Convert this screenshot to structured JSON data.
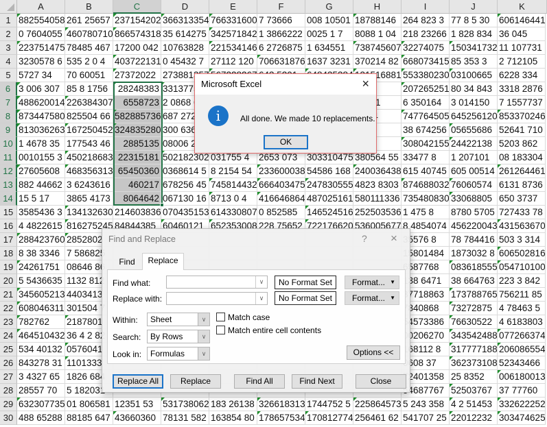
{
  "sheet": {
    "columns": [
      "A",
      "B",
      "C",
      "D",
      "E",
      "F",
      "G",
      "H",
      "I",
      "J",
      "K"
    ],
    "selected_column": "C",
    "selected_rows": [
      6,
      7,
      8,
      9,
      10,
      11,
      12,
      13,
      14
    ],
    "selection_range": "C6:C14",
    "active_cell": "C6",
    "accent_color": "#217346",
    "error_indicator_color": "#1e8f2c",
    "rows": [
      {
        "n": "1",
        "cells": [
          "882554058",
          "261 25657",
          "237154202",
          "366313354",
          "766331600",
          "7 73666",
          "008 10501",
          "18788146",
          "264 823 3",
          "77 8 5 30",
          "606146441"
        ],
        "flags": "ACDEHK"
      },
      {
        "n": "2",
        "cells": [
          "0 7604055",
          "460780710",
          "866574318",
          "35 614275",
          "342571842",
          "1 3866222",
          "0025 1 7",
          "8088 1 04",
          "218 23266",
          "1 828 834",
          "36   045"
        ],
        "flags": "BCE"
      },
      {
        "n": "3",
        "cells": [
          "223751475",
          "78485 467",
          "17200 042",
          "10763828",
          "221534146",
          "6 2726875",
          "1 634551",
          "738745607",
          "32274075",
          "150341732",
          "11 107731"
        ],
        "flags": "AEHIJ"
      },
      {
        "n": "4",
        "cells": [
          "3230578 6",
          "535 2 0 4",
          "403722131",
          "0 45432 7",
          "27112 120",
          "706631876",
          "1637 3231",
          "370214 82",
          "668073415",
          "85 353 3",
          "2 712105"
        ],
        "flags": "CFI"
      },
      {
        "n": "5",
        "cells": [
          "5727 34",
          "70  60051",
          "27372022",
          "273881357",
          "567228267",
          "643  5201",
          "648435384",
          "131516881",
          "553380230",
          "03100665",
          "6228 334"
        ],
        "flags": "CEGHIJ"
      },
      {
        "n": "6",
        "cells": [
          "3 006 307",
          "85 8 1756",
          "28248383",
          "3313775",
          "",
          "",
          "",
          "6745",
          "207265251",
          "80 34 843",
          "3318 2876"
        ],
        "flags": "ACDI"
      },
      {
        "n": "7",
        "cells": [
          "488620014",
          "226384307",
          "6558723",
          "2 0868 6",
          "",
          "",
          "",
          "73831",
          "6  350164",
          "3 014150",
          "7 1557737"
        ],
        "flags": "AB"
      },
      {
        "n": "8",
        "cells": [
          "873447580",
          "825504 66",
          "582885736",
          "687 272",
          "",
          "",
          "",
          "517 4",
          "747764505",
          "645256120",
          "853370246"
        ],
        "flags": "ACIK"
      },
      {
        "n": "9",
        "cells": [
          "813036263",
          "167250452",
          "324835280",
          "300 636",
          "",
          "",
          "",
          "0036",
          "38 674256",
          "05655686",
          "52641 710"
        ],
        "flags": "ABCJ"
      },
      {
        "n": "10",
        "cells": [
          "1 4678 35",
          "177543 46",
          "2885135",
          "08006 2",
          "",
          "",
          "",
          "5255",
          "308042155",
          "24422138",
          "5203 862"
        ],
        "flags": "IJ"
      },
      {
        "n": "11",
        "cells": [
          "0010155 3",
          "450218683",
          "22315181",
          "502182302",
          "031755  4",
          "2653 073",
          "303310475",
          "380564 55",
          "33477 8",
          "1  207101",
          "08 183304"
        ],
        "flags": "BD"
      },
      {
        "n": "12",
        "cells": [
          "27605608",
          "468356313",
          "65450360",
          "0368614 5",
          "8 2154 54",
          "233600038",
          "54586 168",
          "240036438",
          "615 40745",
          "605 00514",
          "261264461"
        ],
        "flags": "ABFHK"
      },
      {
        "n": "13",
        "cells": [
          "882 44662",
          "3 6243616",
          "460217",
          "678256 45",
          "745814432",
          "666403475",
          "247830555",
          "4823 8303",
          "874688032",
          "76060574",
          "6131 8736"
        ],
        "flags": "EFGIJ"
      },
      {
        "n": "14",
        "cells": [
          "15 5  17",
          "3865 4173",
          "8064642",
          "067130 16",
          "8713 0 4",
          "416646864",
          "487025161",
          "580111336",
          "735480830",
          "33068805",
          "650  3737"
        ],
        "flags": "EFJ"
      },
      {
        "n": "15",
        "cells": [
          "3585436 3",
          "134132630",
          "214603836",
          "070435153",
          "614330807",
          "0 852585",
          "146524516",
          "252503536",
          "1   475 8",
          "8780 5705",
          "727433 78"
        ],
        "flags": "BG"
      },
      {
        "n": "16",
        "cells": [
          "4 4822615",
          "816275245",
          "84844385",
          "60460121",
          "652353008",
          "228 75652",
          "722176620",
          "536005677",
          "8 4854074",
          "456220043",
          "431563670"
        ],
        "flags": "BDEGK"
      },
      {
        "n": "17",
        "cells": [
          "288423760",
          "2852802",
          "",
          "",
          "",
          "",
          "",
          "",
          "35576 8",
          "78 784416",
          "503 3 314"
        ],
        "flags": "AB"
      },
      {
        "n": "18",
        "cells": [
          "8 38 3346",
          "7 586825",
          "",
          "",
          "",
          "",
          "",
          "",
          "15801484",
          "1873032 8",
          "606502816"
        ],
        "flags": "K"
      },
      {
        "n": "19",
        "cells": [
          "24261751",
          "08646 86",
          "",
          "",
          "",
          "",
          "",
          "",
          "6587768",
          "083618555",
          "054710100"
        ],
        "flags": "AJK"
      },
      {
        "n": "20",
        "cells": [
          "5 5436635",
          "1132 812",
          "",
          "",
          "",
          "",
          "",
          "",
          "138 6471",
          "38 664763",
          "223 3 842"
        ],
        "flags": ""
      },
      {
        "n": "21",
        "cells": [
          "345605213",
          "4403413",
          "",
          "",
          "",
          "",
          "",
          "",
          "37718863",
          "173788765",
          "756211 85"
        ],
        "flags": "AJ"
      },
      {
        "n": "22",
        "cells": [
          "608046311",
          "301504 7",
          "",
          "",
          "",
          "",
          "",
          "",
          "7840868",
          "73272875",
          "4 78463 5"
        ],
        "flags": "AJ"
      },
      {
        "n": "23",
        "cells": [
          "782762",
          "2187801",
          "",
          "",
          "",
          "",
          "",
          "",
          "54573386",
          "76630522",
          "4 6183803"
        ],
        "flags": "ABJ"
      },
      {
        "n": "24",
        "cells": [
          "464510432",
          "36 4 2 82",
          "",
          "",
          "",
          "",
          "",
          "",
          "00206270",
          "343542488",
          "077266374"
        ],
        "flags": "AJK"
      },
      {
        "n": "25",
        "cells": [
          "534 40132",
          "0576041",
          "",
          "",
          "",
          "",
          "",
          "",
          "168112 8",
          "317777188",
          "206086554"
        ],
        "flags": "BJK"
      },
      {
        "n": "26",
        "cells": [
          "843278 31",
          "1101333",
          "",
          "",
          "",
          "",
          "",
          "",
          "0608 37",
          "362373108",
          "52343466"
        ],
        "flags": "BJ"
      },
      {
        "n": "27",
        "cells": [
          "3 4327 65",
          "1826 684",
          "",
          "",
          "",
          "",
          "",
          "",
          "72401358",
          "25 8352",
          "006180013"
        ],
        "flags": "K"
      },
      {
        "n": "28",
        "cells": [
          "28557 70",
          "5 182031",
          "",
          "",
          "",
          "",
          "",
          "",
          "54687767",
          "52503767",
          "37  77760"
        ],
        "flags": "J"
      },
      {
        "n": "29",
        "cells": [
          "632307735",
          "01 806581",
          "12351 53",
          "531738062",
          "183 26138",
          "326618313",
          "1744752 5",
          "225864573",
          "5 243 358",
          "4 2 51453",
          "332622252"
        ],
        "flags": "ADFHJK"
      },
      {
        "n": "30",
        "cells": [
          "488 65288",
          "88185 647",
          "43660360",
          "78131 582",
          "163854 80",
          "178657534",
          "170812774",
          "256461 62",
          "541707 25",
          "22012232",
          "303474625"
        ],
        "flags": "CFGJK"
      }
    ]
  },
  "message_box": {
    "title": "Microsoft Excel",
    "message": "All done. We made 10 replacements.",
    "ok_label": "OK",
    "close_icon": "×",
    "info_icon": "i"
  },
  "find_replace": {
    "title": "Find and Replace",
    "help_icon": "?",
    "close_icon": "×",
    "tabs": [
      {
        "label": "Find",
        "active": false
      },
      {
        "label": "Replace",
        "active": true
      }
    ],
    "find_what_label": "Find what:",
    "find_what_value": "",
    "replace_with_label": "Replace with:",
    "replace_with_value": "",
    "no_format_label": "No Format Set",
    "format_label": "Format...",
    "within_label": "Within:",
    "within_value": "Sheet",
    "search_label": "Search:",
    "search_value": "By Rows",
    "look_in_label": "Look in:",
    "look_in_value": "Formulas",
    "match_case_label": "Match case",
    "match_case_checked": false,
    "match_entire_label": "Match entire cell contents",
    "match_entire_checked": false,
    "options_label": "Options <<",
    "buttons": {
      "replace_all": "Replace All",
      "replace": "Replace",
      "find_all": "Find All",
      "find_next": "Find Next",
      "close": "Close"
    }
  }
}
